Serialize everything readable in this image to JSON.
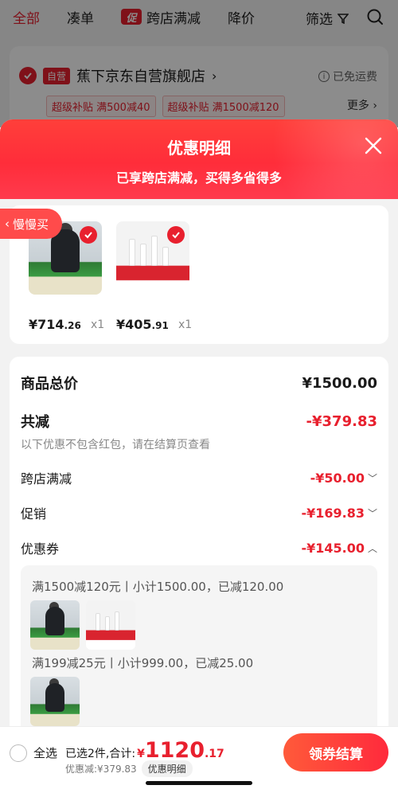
{
  "background": {
    "tabs": [
      {
        "label": "全部",
        "active": true
      },
      {
        "label": "凑单",
        "active": false
      },
      {
        "label": "跨店满减",
        "badge": "促",
        "active": false
      },
      {
        "label": "降价",
        "active": false
      }
    ],
    "filter_label": "筛选",
    "store": {
      "self_tag": "自营",
      "name": "蕉下京东自营旗舰店",
      "free_shipping": "已免运费",
      "coupons": [
        "超级补贴 满500减40",
        "超级补贴 满1500减120"
      ],
      "more_label": "更多"
    }
  },
  "sheet": {
    "title": "优惠明细",
    "subtitle": "已享跨店满减，买得多省得多",
    "slow_buy_label": "慢慢买",
    "products": [
      {
        "price_int": "¥714",
        "price_dec": ".26",
        "qty": "x1",
        "thumb": "down-jacket"
      },
      {
        "price_int": "¥405",
        "price_dec": ".91",
        "qty": "x1",
        "thumb": "cosmetics-set"
      }
    ],
    "detail": {
      "total_label": "商品总价",
      "total_value": "¥1500.00",
      "discount_label": "共减",
      "discount_value": "-¥379.83",
      "note": "以下优惠不包含红包，请在结算页查看",
      "lines": [
        {
          "label": "跨店满减",
          "value": "-¥50.00",
          "chevron": "﹀"
        },
        {
          "label": "促销",
          "value": "-¥169.83",
          "chevron": "﹀"
        },
        {
          "label": "优惠券",
          "value": "-¥145.00",
          "chevron": "︿"
        }
      ],
      "coupon_groups": [
        {
          "text": "满1500减120元丨小计1500.00，已减120.00",
          "thumbs": [
            "down-jacket",
            "cosmetics-set"
          ]
        },
        {
          "text": "满199减25元丨小计999.00，已减25.00",
          "thumbs": [
            "down-jacket"
          ]
        }
      ]
    }
  },
  "bottom_bar": {
    "select_all": "全选",
    "selected_text": "已选2件,合计:",
    "currency": "¥",
    "total_int": "1120",
    "total_dec": ".17",
    "saved_text": "优惠减:¥379.83",
    "detail_pill": "优惠明细",
    "checkout_label": "领券结算"
  },
  "colors": {
    "accent": "#e8202e",
    "header_start": "#ff3f3a",
    "header_end": "#ff3a4d"
  }
}
